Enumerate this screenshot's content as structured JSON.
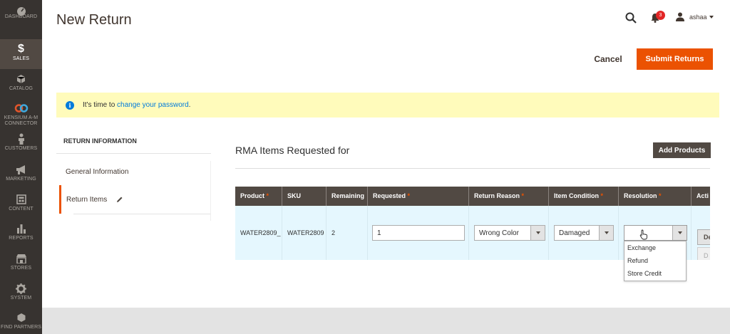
{
  "sidebar": {
    "items": [
      {
        "label": "DASHBOARD",
        "icon": "dashboard-icon"
      },
      {
        "label": "SALES",
        "icon": "dollar-icon"
      },
      {
        "label": "CATALOG",
        "icon": "cube-icon"
      },
      {
        "label": "KENSIUM A-M CONNECTOR",
        "icon": "connector-icon"
      },
      {
        "label": "CUSTOMERS",
        "icon": "person-icon"
      },
      {
        "label": "MARKETING",
        "icon": "megaphone-icon"
      },
      {
        "label": "CONTENT",
        "icon": "layout-icon"
      },
      {
        "label": "REPORTS",
        "icon": "bar-chart-icon"
      },
      {
        "label": "STORES",
        "icon": "store-icon"
      },
      {
        "label": "SYSTEM",
        "icon": "gear-icon"
      },
      {
        "label": "FIND PARTNERS",
        "icon": "partners-icon"
      }
    ],
    "active": "SALES"
  },
  "header": {
    "title": "New Return",
    "notification_count": "3",
    "username": "ashaa"
  },
  "actions": {
    "cancel_label": "Cancel",
    "submit_label": "Submit Returns"
  },
  "notice": {
    "prefix": "It's time to ",
    "link_text": "change your password",
    "suffix": "."
  },
  "tabs": {
    "title": "RETURN INFORMATION",
    "general": "General Information",
    "return_items": "Return Items"
  },
  "rma": {
    "title": "RMA Items Requested for",
    "add_products_label": "Add Products"
  },
  "grid": {
    "columns": [
      "Product",
      "SKU",
      "Remaining",
      "Requested",
      "Return Reason",
      "Item Condition",
      "Resolution",
      "Acti"
    ],
    "required_mark": "*",
    "row": {
      "product": "WATER2809_",
      "sku": "WATER2809",
      "remaining": "2",
      "requested": "1",
      "return_reason": "Wrong Color",
      "item_condition": "Damaged",
      "resolution": "",
      "action_label": "De",
      "action_label2": "D"
    },
    "resolution_options": [
      "Exchange",
      "Refund",
      "Store Credit"
    ]
  },
  "colors": {
    "accent": "#eb5202",
    "sidebar": "#373330",
    "grid_header": "#514943",
    "link": "#007bdb",
    "notice_bg": "#fffbbb",
    "row_bg": "#e5f7fe"
  }
}
